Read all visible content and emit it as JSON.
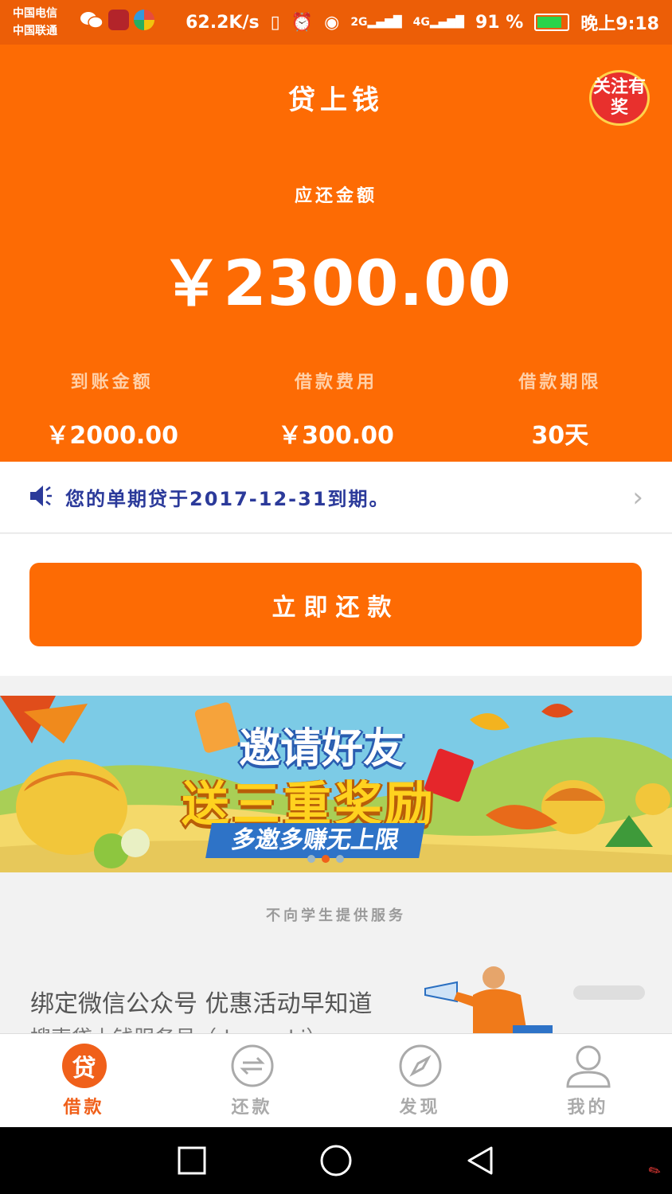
{
  "status_bar": {
    "carrier_1": "中国电信",
    "carrier_2": "中国联通",
    "speed": "62.2K/s",
    "network_1": "2G",
    "network_2": "4G",
    "battery": "91 %",
    "time": "晚上9:18"
  },
  "header": {
    "title": "贷上钱",
    "promo_badge": "关注有奖"
  },
  "summary": {
    "due_label": "应还金额",
    "due_amount": "￥2300.00",
    "stats": [
      {
        "label": "到账金额",
        "value": "￥2000.00"
      },
      {
        "label": "借款费用",
        "value": "￥300.00"
      },
      {
        "label": "借款期限",
        "value": "30天"
      }
    ]
  },
  "notice": {
    "text": "您的单期贷于2017-12-31到期。"
  },
  "repay_button": "立即还款",
  "banner": {
    "line1": "邀请好友",
    "line2": "送三重奖励",
    "line3": "多邀多赚无上限"
  },
  "disclaimer": "不向学生提供服务",
  "wechat_card": {
    "title": "绑定微信公众号  优惠活动早知道",
    "subtitle": "搜索贷上钱服务号（daomuki）"
  },
  "tabs": [
    {
      "label": "借款",
      "icon": "loan-icon",
      "active": true
    },
    {
      "label": "还款",
      "icon": "repay-icon",
      "active": false
    },
    {
      "label": "发现",
      "icon": "compass-icon",
      "active": false
    },
    {
      "label": "我的",
      "icon": "profile-icon",
      "active": false
    }
  ],
  "colors": {
    "brand": "#fd6b04",
    "notice_text": "#2b3a9a",
    "tab_inactive": "#aaaaaa"
  }
}
